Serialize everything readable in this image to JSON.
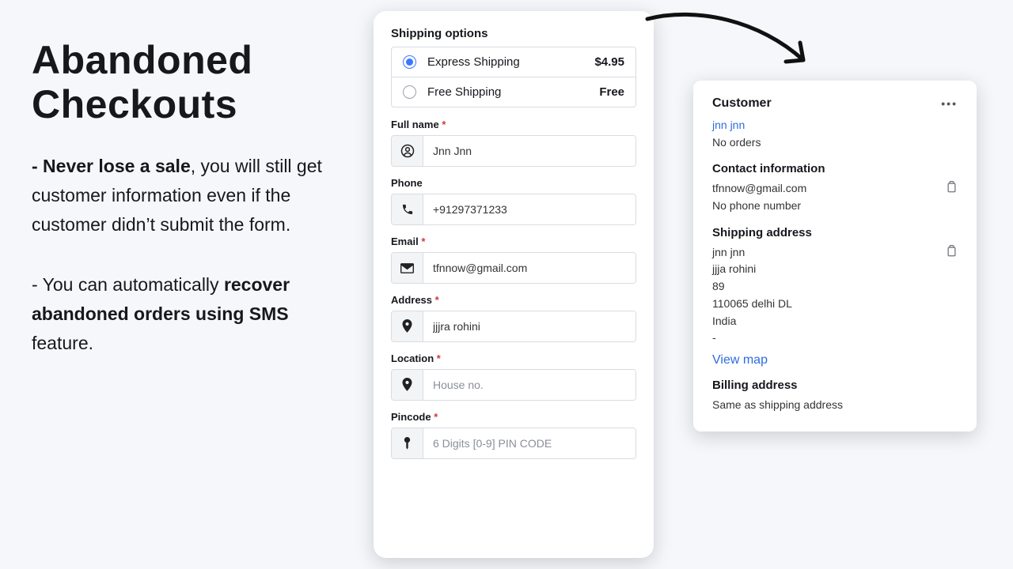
{
  "copy": {
    "heading": "Abandoned Checkouts",
    "p1_lead": "- Never lose a sale",
    "p1_rest": ", you will still get customer information even if the customer didn’t submit the form.",
    "p2_lead": "- You can automatically ",
    "p2_bold": "recover abandoned orders using SMS",
    "p2_rest": " feature."
  },
  "form": {
    "shipping_header": "Shipping options",
    "opts": [
      {
        "name": "Express Shipping",
        "price": "$4.95",
        "selected": true
      },
      {
        "name": "Free Shipping",
        "price": "Free",
        "selected": false
      }
    ],
    "fields": {
      "fullname": {
        "label": "Full name",
        "required": true,
        "value": "Jnn Jnn"
      },
      "phone": {
        "label": "Phone",
        "required": false,
        "value": "+91297371233"
      },
      "email": {
        "label": "Email",
        "required": true,
        "value": "tfnnow@gmail.com"
      },
      "address": {
        "label": "Address",
        "required": true,
        "value": "jjjra rohini"
      },
      "location": {
        "label": "Location",
        "required": true,
        "placeholder": "House no."
      },
      "pincode": {
        "label": "Pincode",
        "required": true,
        "placeholder": "6 Digits [0-9] PIN CODE"
      }
    }
  },
  "card": {
    "title": "Customer",
    "name": "jnn jnn",
    "orders": "No orders",
    "contact_title": "Contact information",
    "email": "tfnnow@gmail.com",
    "no_phone": "No phone number",
    "ship_title": "Shipping address",
    "ship_lines": [
      "jnn jnn",
      "jjja rohini",
      "89",
      "110065 delhi DL",
      "India",
      "-"
    ],
    "view_map": "View map",
    "bill_title": "Billing address",
    "bill_line": "Same as shipping address"
  }
}
